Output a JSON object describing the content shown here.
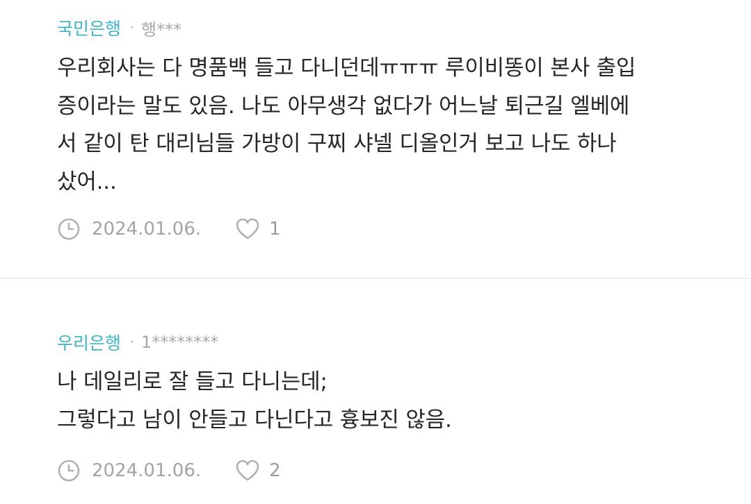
{
  "comments": [
    {
      "bank": "국민은행",
      "separator": "·",
      "user": "행***",
      "text": "우리회사는 다 명품백 들고 다니던데ㅠㅠㅠ 루이비똥이 본사 출입\n증이라는 말도 있음. 나도 아무생각 없다가 어느날 퇴근길 엘베에\n서 같이 탄 대리님들 가방이 구찌 샤넬 디올인거 보고 나도 하나\n샀어...",
      "date": "2024.01.06.",
      "likes": "1"
    },
    {
      "bank": "우리은행",
      "separator": "·",
      "user": "1********",
      "text": "나 데일리로 잘 들고 다니는데;\n그렇다고 남이 안들고 다닌다고 흉보진 않음.",
      "date": "2024.01.06.",
      "likes": "2"
    }
  ],
  "icons": {
    "clock": "clock-icon",
    "heart": "heart-icon"
  },
  "colors": {
    "bank": "#3fb3c6",
    "muted": "#a4a4a4",
    "text": "#262626",
    "icon": "#b0b0b8"
  }
}
